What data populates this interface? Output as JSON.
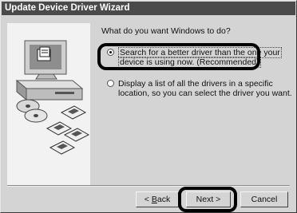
{
  "window": {
    "title": "Update Device Driver Wizard"
  },
  "prompt": "What do you want Windows to do?",
  "options": [
    {
      "line1": "Search for a better driver than the one your",
      "line2": "device is using now. (Recommended)",
      "selected": true
    },
    {
      "line1": "Display a list of all the drivers in a specific",
      "line2": "location, so you can select the driver you want.",
      "selected": false
    }
  ],
  "buttons": {
    "back_prefix": "< ",
    "back_mnemonic": "B",
    "back_rest": "ack",
    "next": "Next >",
    "cancel": "Cancel"
  },
  "colors": {
    "titlebar": "#4a4a4a",
    "dialog_face": "#d4d4d4",
    "highlight_ring": "#000000"
  },
  "icons": [
    "computer-monitor-icon",
    "cd-disc-icon",
    "floppy-disk-icon"
  ]
}
